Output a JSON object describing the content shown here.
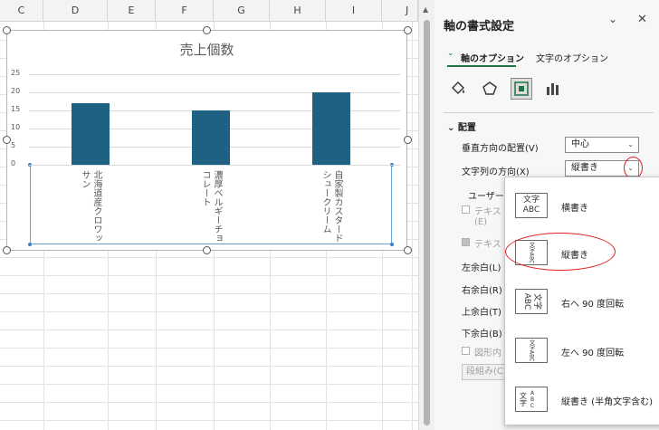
{
  "sheet": {
    "columns": [
      "C",
      "D",
      "E",
      "F",
      "G",
      "H",
      "I",
      "J"
    ]
  },
  "chart_data": {
    "type": "bar",
    "title": "売上個数",
    "categories": [
      "北海道産クロワッサン",
      "濃厚ベルギーチョコレート",
      "自家製カスタードシュークリーム"
    ],
    "values": [
      17,
      15,
      20
    ],
    "ylim": [
      0,
      25
    ],
    "yticks": [
      "25",
      "20",
      "15",
      "10",
      "5",
      "0"
    ],
    "grid": true,
    "bar_color": "#1f6183"
  },
  "pane": {
    "title": "軸の書式設定",
    "collapse_icon": "chevron-down-icon",
    "close_icon": "close-icon",
    "tabs": [
      "軸のオプション",
      "文字のオプション"
    ],
    "section": "配置",
    "rows": {
      "vertical_align_label": "垂直方向の配置(V)",
      "vertical_align_value": "中心",
      "text_direction_label": "文字列の方向(X)",
      "text_direction_value": "縦書き",
      "user_defined": "ユーザー",
      "text_check1": "テキスト",
      "text_check1_sub": "(E)",
      "text_check2": "テキスト",
      "margin_left": "左余白(L)",
      "margin_right": "右余白(R)",
      "margin_top": "上余白(T)",
      "margin_bottom": "下余白(B)",
      "shape_check": "図形内",
      "group_button": "段組み(C"
    }
  },
  "dropdown": {
    "options": [
      {
        "label": "横書き",
        "icon_text_1": "文字",
        "icon_text_2": "ABC"
      },
      {
        "label": "縦書き",
        "icon_text_1": "文字",
        "icon_text_2": "ABC"
      },
      {
        "label": "右へ 90 度回転",
        "icon_text_1": "文字",
        "icon_text_2": "ABC"
      },
      {
        "label": "左へ 90 度回転",
        "icon_text_1": "文字",
        "icon_text_2": "ABC"
      },
      {
        "label": "縦書き (半角文字含む)",
        "icon_text_1": "文字",
        "icon_text_2": "ABC"
      }
    ],
    "selected_index": 1
  },
  "highlight_color": "#e02020",
  "accent": "#217346"
}
